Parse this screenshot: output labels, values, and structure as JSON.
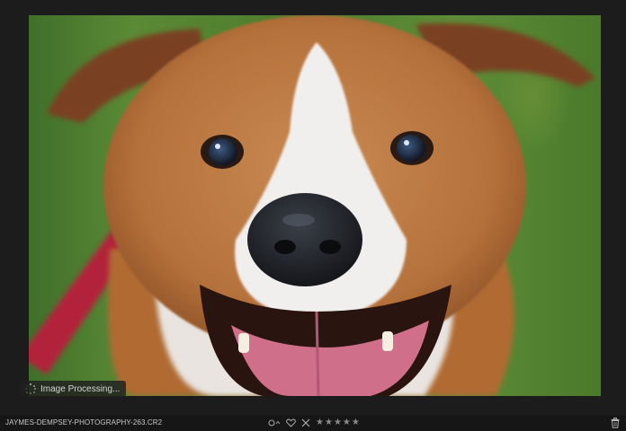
{
  "image": {
    "subject": "dog-photo"
  },
  "overlay": {
    "processing_text": "Image Processing..."
  },
  "statusbar": {
    "filename": "JAYMES-DEMPSEY-PHOTOGRAPHY-263.CR2",
    "rating_stars": 5,
    "rating_value": 0,
    "icons": [
      "color-label-icon",
      "heart-icon",
      "reject-icon",
      "star-icon",
      "trash-icon"
    ]
  },
  "colors": {
    "background": "#1c1c1c",
    "statusbar": "#161616",
    "star_inactive": "#8a8a8a"
  }
}
